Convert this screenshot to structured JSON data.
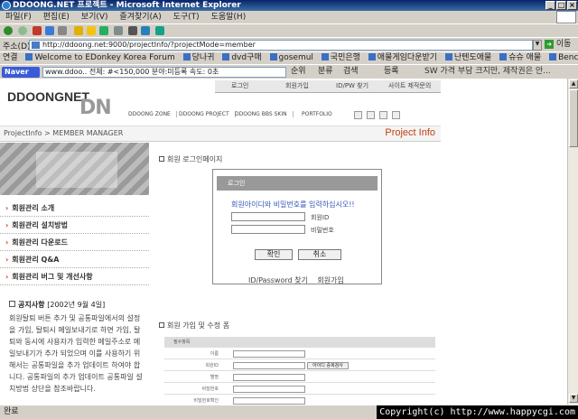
{
  "window": {
    "title": "DDOONG.NET 프로젝트 - Microsoft Internet Explorer"
  },
  "menu": [
    "파일(F)",
    "편집(E)",
    "보기(V)",
    "즐겨찾기(A)",
    "도구(T)",
    "도움말(H)"
  ],
  "address": {
    "label": "주소(D)",
    "url": "http://ddoong.net:9000/projectInfo/?projectMode=member",
    "go_label": "이동"
  },
  "links": {
    "label": "연결",
    "items": [
      "Welcome to EDonkey Korea Forum",
      "당나귀",
      "dvd구매",
      "gosemul",
      "국민은행",
      "애물게임다운받기",
      "난텐도애물",
      "슈슈 애물",
      "Benchbee"
    ]
  },
  "naver": {
    "logo": "Naver",
    "search_value": "www.ddoo..    전체: #<150,000  분야:미등록     속도: 0초",
    "items": [
      "순위",
      "분류",
      "검색",
      "등록"
    ],
    "ad_text": "SW 가격 부담 크지만, 제작권은 안..."
  },
  "site": {
    "logo_text": "DDOONGNET",
    "logo_dn": "DN",
    "top_nav": [
      "로그인",
      "회원가입",
      "ID/PW 찾기",
      "사이트 제작문의"
    ],
    "sub_nav": [
      "DDOONG ZONE",
      "DDOONG PROJECT",
      "DDOONG BBS SKIN",
      "PORTFOLIO"
    ],
    "breadcrumb": "ProjectInfo > MEMBER MANAGER",
    "section_title": "Project Info"
  },
  "sidebar": {
    "items": [
      "회원관리 소개",
      "회원관리 설치방법",
      "회원관리 다운로드",
      "회원관리 Q&A",
      "회원관리 버그 및 개선사항"
    ]
  },
  "notice": {
    "title": "공지사항",
    "date": "[2002년 9월 4일]",
    "body": "회원탈퇴 버튼 추가 및 공통파일에서의 설정을 가입, 탈퇴시 메일보내기로 하면 가입, 탈퇴와 동시에 사용자가 입력한 메일주소로 메일보내기가 추가 되었으며 이를 사용하기 위해서는 공통파일을 추가 업데이트 하여야 합니다. 공통파일의 추가 업데이트 공통파일 설치방법 상단을 참조바랍니다."
  },
  "login": {
    "section_title": "회원 로그인페이지",
    "box_title": "로그인",
    "message": "회원아이디와 비밀번호를 입력하십시오!!",
    "id_label": "회원ID",
    "pw_label": "비밀번호",
    "confirm_button": "확인",
    "cancel_button": "취소",
    "find_link": "ID/Password 찾기",
    "join_link": "회원가입"
  },
  "register": {
    "section_title": "회원 가입 및 수정 폼",
    "header": "필수항목",
    "fields": [
      "이름",
      "회원ID",
      "별명",
      "비밀번호",
      "비밀번호확인"
    ],
    "check_button": "아이디 중복검사"
  },
  "status": {
    "text": "완료",
    "copyright": "Copyright(c) http://www.happycgi.com"
  }
}
